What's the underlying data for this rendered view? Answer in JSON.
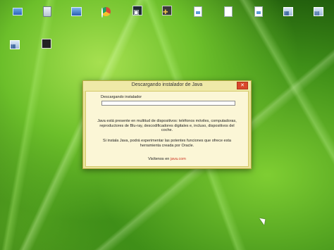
{
  "desktop": {
    "icons": [
      {
        "name": "computer-icon"
      },
      {
        "name": "recycle-bin-icon"
      },
      {
        "name": "network-icon"
      },
      {
        "name": "chrome-icon"
      },
      {
        "name": "app-dark-icon"
      },
      {
        "name": "tools-icon"
      },
      {
        "name": "document-image-icon"
      },
      {
        "name": "blank-document-icon"
      },
      {
        "name": "document-image-2-icon"
      },
      {
        "name": "window-app-icon"
      },
      {
        "name": "window-app-2-icon"
      },
      {
        "name": "shortcut-icon"
      },
      {
        "name": "red-app-icon"
      }
    ]
  },
  "dialog": {
    "title": "Descargando instalador de Java",
    "close_label": "✕",
    "progress_label": "Descargando instalador",
    "progress": 0,
    "description_1": "Java está presente en multitud de dispositivos: teléfonos móviles, computadoras, reproductores de Blu-ray, descodificadores digitales e, incluso, dispositivos del coche.",
    "description_2": "Si instala Java, podrá experimentar las potentes funciones que ofrece esta herramienta creada por Oracle.",
    "visit_text": "Visítenos en",
    "visit_link": "java.com"
  },
  "colors": {
    "dialog_background": "#e9e39a",
    "client_background": "#fbf6d6",
    "close_button": "#d9472b",
    "link": "#cc3322"
  }
}
